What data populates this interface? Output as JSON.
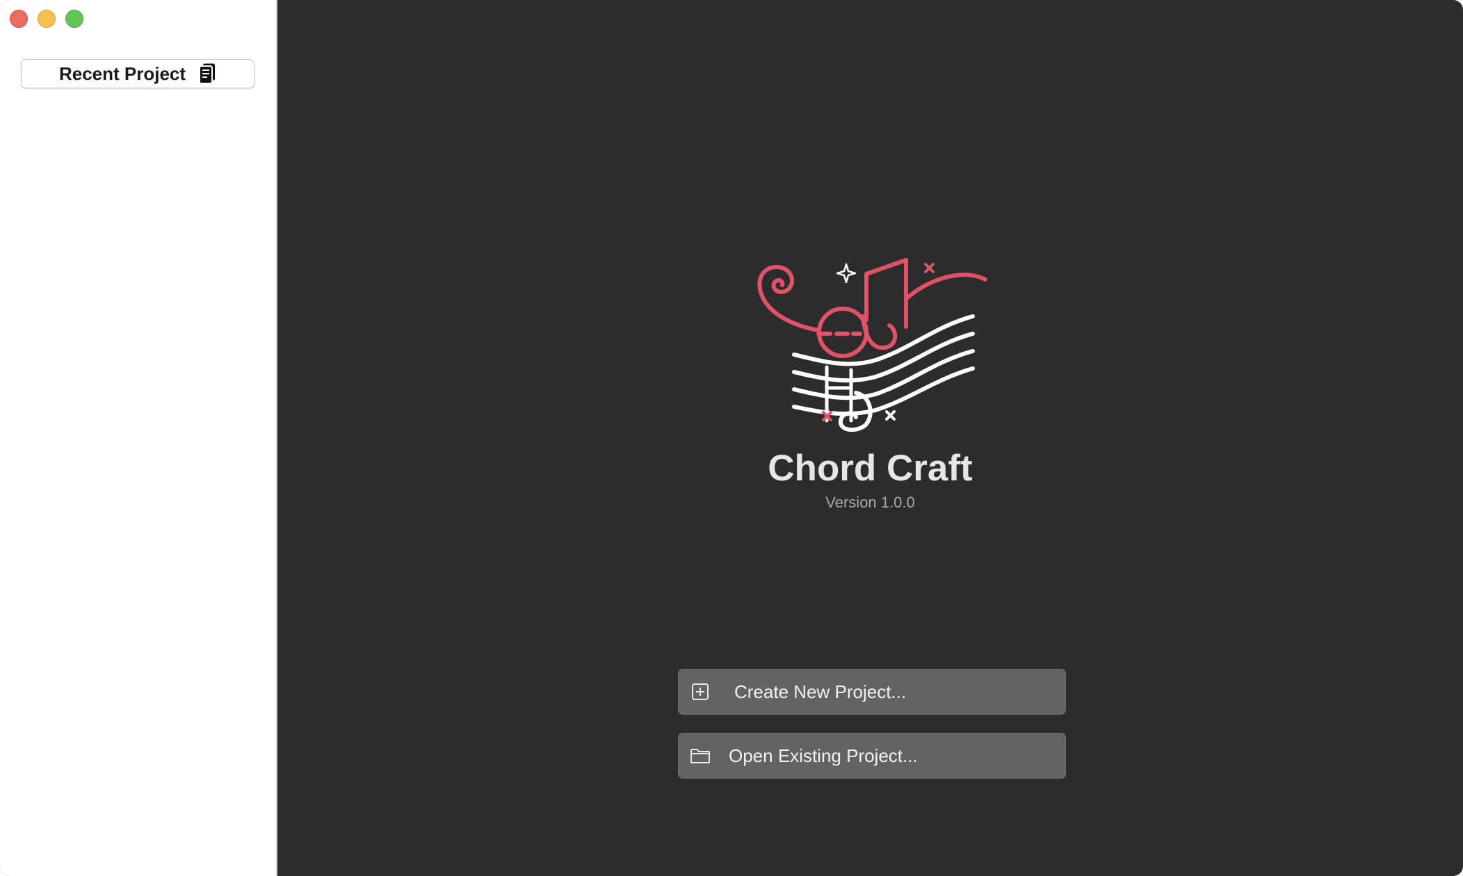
{
  "sidebar": {
    "recent_project_label": "Recent Project",
    "recent_project_icon": "document-stack-icon"
  },
  "app": {
    "name": "Chord Craft",
    "version": "Version 1.0.0",
    "logo_icon": "music-notes-staff-logo"
  },
  "actions": {
    "create_label": "Create New Project...",
    "create_icon": "plus-square-icon",
    "open_label": "Open Existing Project...",
    "open_icon": "folder-icon"
  },
  "colors": {
    "main_background": "#2c2c2c",
    "sidebar_background": "#ffffff",
    "accent_pink": "#e05267",
    "button_background": "#636363",
    "title_text": "#e6e6e6",
    "version_text": "#a8a8a8"
  }
}
